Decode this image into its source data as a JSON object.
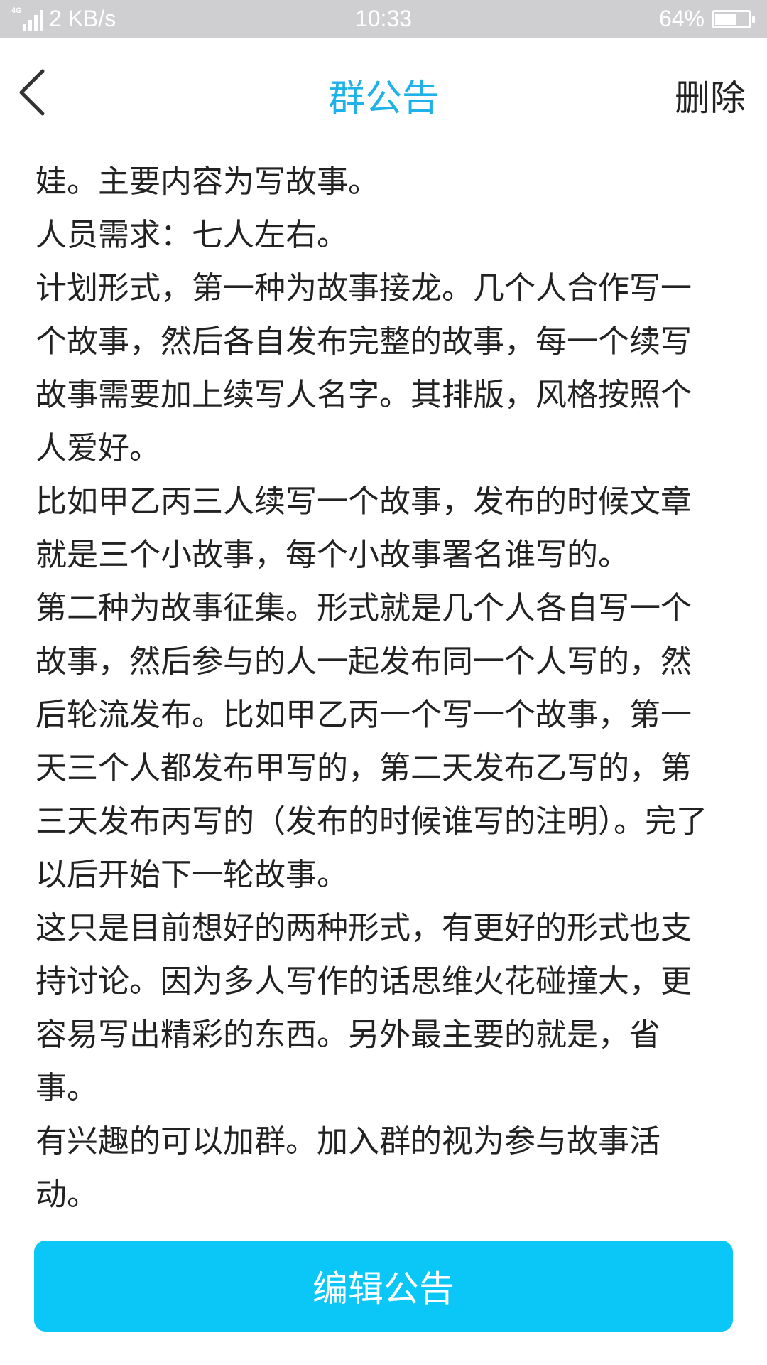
{
  "status_bar": {
    "network": "4G",
    "speed": "2 KB/s",
    "time": "10:33",
    "battery_percent_text": "64%",
    "battery_level": 0.64
  },
  "nav": {
    "title": "群公告",
    "delete_label": "删除",
    "back_icon": "chevron-left-icon"
  },
  "announcement": {
    "paragraphs": [
      "娃。主要内容为写故事。",
      "人员需求：七人左右。",
      "计划形式，第一种为故事接龙。几个人合作写一个故事，然后各自发布完整的故事，每一个续写故事需要加上续写人名字。其排版，风格按照个人爱好。",
      "比如甲乙丙三人续写一个故事，发布的时候文章就是三个小故事，每个小故事署名谁写的。",
      "第二种为故事征集。形式就是几个人各自写一个故事，然后参与的人一起发布同一个人写的，然后轮流发布。比如甲乙丙一个写一个故事，第一天三个人都发布甲写的，第二天发布乙写的，第三天发布丙写的（发布的时候谁写的注明）。完了以后开始下一轮故事。",
      "这只是目前想好的两种形式，有更好的形式也支持讨论。因为多人写作的话思维火花碰撞大，更容易写出精彩的东西。另外最主要的就是，省事。",
      "有兴趣的可以加群。加入群的视为参与故事活动。"
    ]
  },
  "edit_button_label": "编辑公告",
  "colors": {
    "status_bar_bg": "#cfcfd1",
    "title_blue": "#1eb2e8",
    "button_blue": "#0bc7f7",
    "text": "#222222"
  }
}
